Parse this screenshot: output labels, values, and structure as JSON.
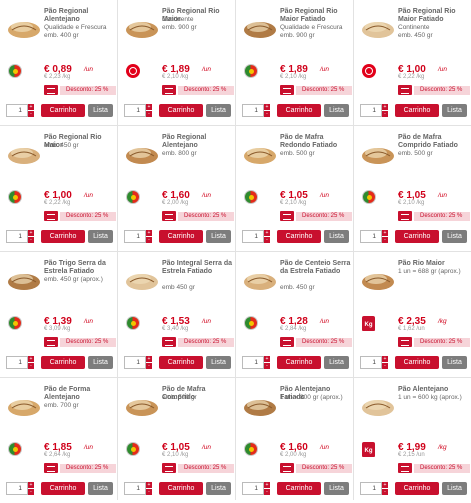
{
  "labels": {
    "cart_button": "Carrinho",
    "list_button": "Lista",
    "qty_default": "1"
  },
  "colors": {
    "accent_red": "#c8102e",
    "price_red": "#d0021b",
    "promo_bg": "#f6d4d9",
    "list_grey": "#7d7d7d"
  },
  "products": [
    {
      "name": "Pão Regional Alentejano",
      "subtitle": "Qualidade e Frescura",
      "detail": "emb. 400 gr",
      "price": "€ 0,89",
      "unit": "/un",
      "per_kg": "€ 2,23 /kg",
      "promo": "Desconto: 25 %",
      "origin_icon": "portugal-flag-icon"
    },
    {
      "name": "Pão Regional Rio Maior",
      "subtitle": "Continente",
      "detail": "emb. 900 gr",
      "price": "€ 1,89",
      "unit": "/un",
      "per_kg": "€ 2,10 /kg",
      "promo": "Desconto: 25 %",
      "origin_icon": "continente-logo-icon"
    },
    {
      "name": "Pão Regional Rio Maior Fatiado",
      "subtitle": "Qualidade e Frescura",
      "detail": "emb. 900 gr",
      "price": "€ 1,89",
      "unit": "/un",
      "per_kg": "€ 2,10 /kg",
      "promo": "Desconto: 25 %",
      "origin_icon": "portugal-flag-icon"
    },
    {
      "name": "Pão Regional Rio Maior Fatiado",
      "subtitle": "Continente",
      "detail": "emb. 450 gr",
      "price": "€ 1,00",
      "unit": "/un",
      "per_kg": "€ 2,22 /kg",
      "promo": "Desconto: 25 %",
      "origin_icon": "continente-logo-icon"
    },
    {
      "name": "Pão Regional Rio Maior",
      "subtitle": "",
      "detail": "emb. 450 gr",
      "price": "€ 1,00",
      "unit": "/un",
      "per_kg": "€ 2,22 /kg",
      "promo": "Desconto: 25 %",
      "origin_icon": "portugal-flag-icon"
    },
    {
      "name": "Pão Regional Alentejano",
      "subtitle": "",
      "detail": "emb. 800 gr",
      "price": "€ 1,60",
      "unit": "/un",
      "per_kg": "€ 2,00 /kg",
      "promo": "Desconto: 25 %",
      "origin_icon": "portugal-flag-icon"
    },
    {
      "name": "Pão de Mafra Redondo Fatiado",
      "subtitle": "",
      "detail": "emb. 500 gr",
      "price": "€ 1,05",
      "unit": "/un",
      "per_kg": "€ 2,10 /kg",
      "promo": "Desconto: 25 %",
      "origin_icon": "portugal-flag-icon"
    },
    {
      "name": "Pão de Mafra Comprido Fatiado",
      "subtitle": "",
      "detail": "emb. 500 gr",
      "price": "€ 1,05",
      "unit": "/un",
      "per_kg": "€ 2,10 /kg",
      "promo": "Desconto: 25 %",
      "origin_icon": "portugal-flag-icon"
    },
    {
      "name": "Pão Trigo Serra da Estrela Fatiado",
      "subtitle": "",
      "detail": "emb. 450 gr (aprox.)",
      "price": "€ 1,39",
      "unit": "/un",
      "per_kg": "€ 3,09 /kg",
      "promo": "Desconto: 25 %",
      "origin_icon": "portugal-flag-icon"
    },
    {
      "name": "Pão Integral Serra da Estrela Fatiado",
      "subtitle": "",
      "detail": "emb 450 gr",
      "price": "€ 1,53",
      "unit": "/un",
      "per_kg": "€ 3,40 /kg",
      "promo": "Desconto: 25 %",
      "origin_icon": "portugal-flag-icon"
    },
    {
      "name": "Pão de Centeio Serra da Estrela Fatiado",
      "subtitle": "",
      "detail": "emb. 450 gr",
      "price": "€ 1,28",
      "unit": "/un",
      "per_kg": "€ 2,84 /kg",
      "promo": "Desconto: 25 %",
      "origin_icon": "portugal-flag-icon"
    },
    {
      "name": "Pão Rio Maior",
      "subtitle": "",
      "detail": "1 un = 688 gr (aprox.)",
      "price": "€ 2,35",
      "unit": "/kg",
      "per_kg": "€ 1,62 /un",
      "promo": "Desconto: 25 %",
      "origin_icon": "kg-weight-icon"
    },
    {
      "name": "Pão de Forma Alentejano",
      "subtitle": "",
      "detail": "emb. 700 gr",
      "price": "€ 1,85",
      "unit": "/un",
      "per_kg": "€ 2,64 /kg",
      "promo": "Desconto: 25 %",
      "origin_icon": "portugal-flag-icon"
    },
    {
      "name": "Pão de Mafra Comprido",
      "subtitle": "",
      "detail": "emb. 500 gr",
      "price": "€ 1,05",
      "unit": "/un",
      "per_kg": "€ 2,10 /kg",
      "promo": "Desconto: 25 %",
      "origin_icon": "portugal-flag-icon"
    },
    {
      "name": "Pão Alentejano Fatiado",
      "subtitle": "",
      "detail": "1 un = 800 gr (aprox.)",
      "price": "€ 1,60",
      "unit": "/un",
      "per_kg": "€ 2,00 /kg",
      "promo": "Desconto: 25 %",
      "origin_icon": "portugal-flag-icon"
    },
    {
      "name": "Pão Alentejano",
      "subtitle": "",
      "detail": "1 un = 600 kg (aprox.)",
      "price": "€ 1,99",
      "unit": "/kg",
      "per_kg": "€ 2,15 /un",
      "promo": "Desconto: 25 %",
      "origin_icon": "kg-weight-icon"
    }
  ]
}
